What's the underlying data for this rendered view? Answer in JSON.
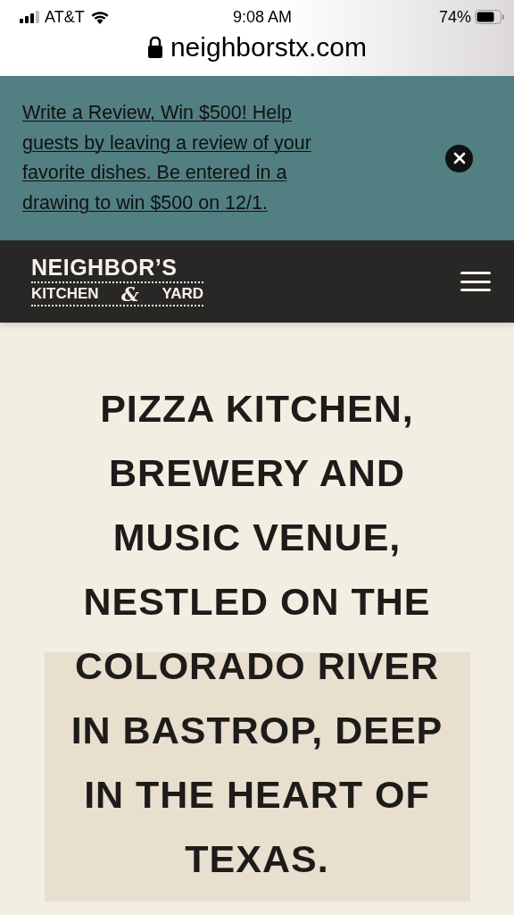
{
  "status_bar": {
    "carrier": "AT&T",
    "time": "9:08 AM",
    "battery": "74%"
  },
  "address_bar": {
    "url": "neighborstx.com"
  },
  "promo_banner": {
    "text": "Write a Review, Win $500! Help guests by leaving a review of your favorite dishes. Be entered in a drawing to win $500 on 12/1."
  },
  "header": {
    "logo": {
      "line_1": "NEIGHBOR’S",
      "line_2_left": "KITCHEN",
      "ampersand": "&",
      "line_2_right": "YARD"
    }
  },
  "hero": {
    "heading": "PIZZA KITCHEN, BREWERY AND MUSIC VENUE, NESTLED ON THE COLORADO RIVER IN BASTROP, DEEP IN THE HEART OF TEXAS."
  }
}
